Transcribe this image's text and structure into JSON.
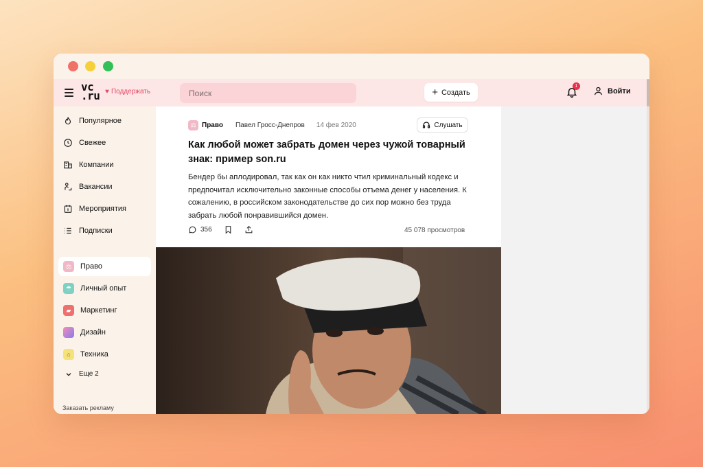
{
  "header": {
    "logo_line1": "vc",
    "logo_line2": ".ru",
    "support_label": "Поддержать",
    "search_placeholder": "Поиск",
    "create_label": "Создать",
    "notifications_count": "1",
    "login_label": "Войти"
  },
  "sidebar": {
    "nav": [
      {
        "label": "Популярное",
        "icon": "flame-icon"
      },
      {
        "label": "Свежее",
        "icon": "clock-icon"
      },
      {
        "label": "Компании",
        "icon": "building-icon"
      },
      {
        "label": "Вакансии",
        "icon": "worker-icon"
      },
      {
        "label": "Мероприятия",
        "icon": "calendar-icon"
      },
      {
        "label": "Подписки",
        "icon": "list-icon"
      }
    ],
    "categories": [
      {
        "label": "Право",
        "color": "#f1b9c7"
      },
      {
        "label": "Личный опыт",
        "color": "#7fd1c4"
      },
      {
        "label": "Маркетинг",
        "color": "#ef6f6f"
      },
      {
        "label": "Дизайн",
        "color": "#b57be6"
      },
      {
        "label": "Техника",
        "color": "#f5e27a"
      }
    ],
    "more_label": "Еще 2",
    "ad_label": "Заказать рекламу"
  },
  "post": {
    "category": "Право",
    "author": "Павел Гросс-Днепров",
    "date": "14 фев 2020",
    "listen_label": "Слушать",
    "title": "Как любой может забрать домен через чужой товарный знак: пример son.ru",
    "lead": "Бендер бы аплодировал, так как он как никто чтил криминальный кодекс и предпочитал исключительно законные способы отъема денег у населения. К сожалению, в российском законодательстве до сих пор можно без труда забрать любой понравившийся домен.",
    "comments": "356",
    "views": "45 078 просмотров"
  },
  "colors": {
    "header_bg": "#fde6e6",
    "accent": "#e24a64",
    "badge": "#e8304a"
  }
}
